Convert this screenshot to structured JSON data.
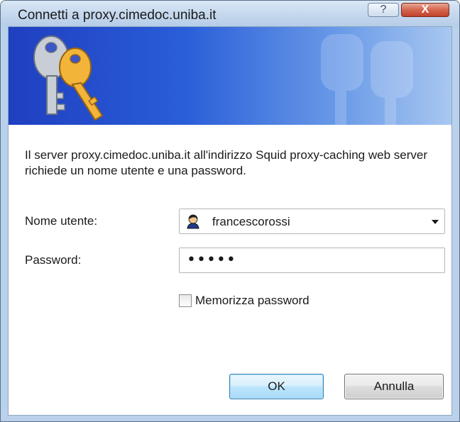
{
  "window": {
    "title": "Connetti a proxy.cimedoc.uniba.it",
    "help_label": "?",
    "close_label": "X"
  },
  "dialog": {
    "message": "Il server proxy.cimedoc.uniba.it all'indirizzo Squid proxy-caching web server richiede un nome utente e una password.",
    "username_label": "Nome utente:",
    "username_value": "francescorossi",
    "password_label": "Password:",
    "password_value": "•••••",
    "remember_label": "Memorizza password",
    "remember_checked": false,
    "ok_label": "OK",
    "cancel_label": "Annulla"
  },
  "icons": {
    "banner": "keys-icon",
    "user": "user-icon",
    "combo": "chevron-down-icon"
  },
  "colors": {
    "banner_start": "#1f3fc0",
    "banner_end": "#a9c7f0",
    "close_button": "#c0422b",
    "ok_border": "#3c7fb1"
  }
}
